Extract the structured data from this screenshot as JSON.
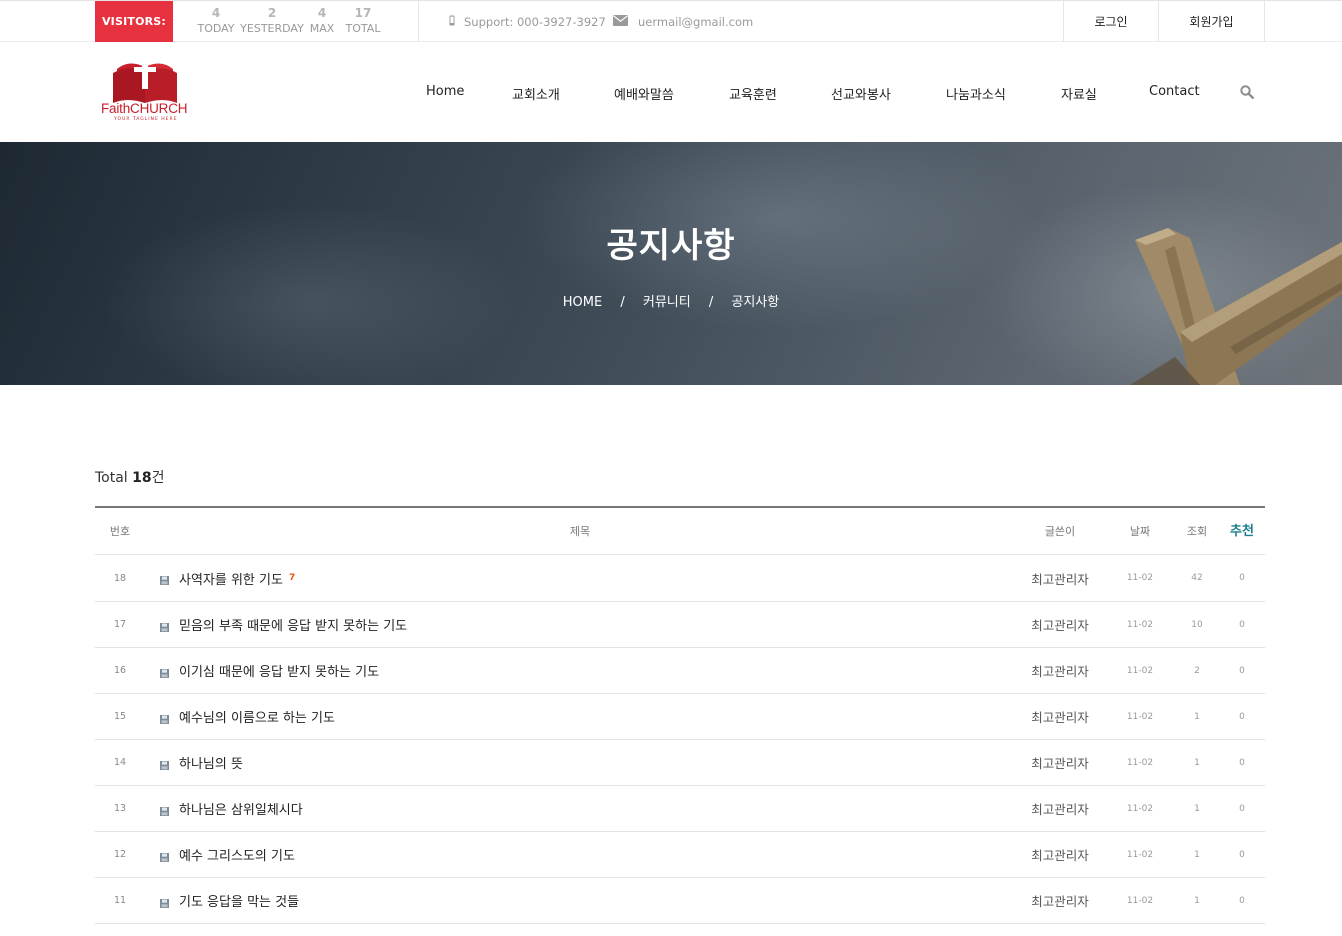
{
  "topbar": {
    "visitors_label": "VISITORS:",
    "stats": [
      {
        "value": "4",
        "label": "TODAY"
      },
      {
        "value": "2",
        "label": "YESTERDAY"
      },
      {
        "value": "4",
        "label": "MAX"
      },
      {
        "value": "17",
        "label": "TOTAL"
      }
    ],
    "support": "Support: 000-3927-3927",
    "email": "uermail@gmail.com",
    "login": "로그인",
    "signup": "회원가입"
  },
  "logo": {
    "name_light": "Faith",
    "name_bold": "CHURCH",
    "tagline": "YOUR TAGLINE HERE"
  },
  "nav": {
    "items": [
      "Home",
      "교회소개",
      "예배와말씀",
      "교육훈련",
      "선교와봉사",
      "나눔과소식",
      "자료실",
      "Contact"
    ]
  },
  "hero": {
    "title": "공지사항",
    "breadcrumb": [
      "HOME",
      "커뮤니티",
      "공지사항"
    ],
    "separator": "/"
  },
  "board": {
    "total_prefix": "Total",
    "total_count": "18",
    "total_suffix": "건",
    "headers": {
      "num": "번호",
      "subject": "제목",
      "writer": "글쓴이",
      "date": "날짜",
      "hits": "조회",
      "recommend": "추천"
    },
    "colors": {
      "accent": "#1d7f8e",
      "badge": "#e8313f",
      "comment": "#e8590c"
    },
    "rows": [
      {
        "num": "18",
        "subject": "사역자를 위한 기도",
        "comments": "7",
        "writer": "최고관리자",
        "date": "11-02",
        "hits": "42",
        "rec": "0"
      },
      {
        "num": "17",
        "subject": "믿음의 부족 때문에 응답 받지 못하는 기도",
        "comments": "",
        "writer": "최고관리자",
        "date": "11-02",
        "hits": "10",
        "rec": "0"
      },
      {
        "num": "16",
        "subject": "이기심 때문에 응답 받지 못하는 기도",
        "comments": "",
        "writer": "최고관리자",
        "date": "11-02",
        "hits": "2",
        "rec": "0"
      },
      {
        "num": "15",
        "subject": "예수님의 이름으로 하는 기도",
        "comments": "",
        "writer": "최고관리자",
        "date": "11-02",
        "hits": "1",
        "rec": "0"
      },
      {
        "num": "14",
        "subject": "하나님의 뜻",
        "comments": "",
        "writer": "최고관리자",
        "date": "11-02",
        "hits": "1",
        "rec": "0"
      },
      {
        "num": "13",
        "subject": "하나님은 삼위일체시다",
        "comments": "",
        "writer": "최고관리자",
        "date": "11-02",
        "hits": "1",
        "rec": "0"
      },
      {
        "num": "12",
        "subject": "예수 그리스도의 기도",
        "comments": "",
        "writer": "최고관리자",
        "date": "11-02",
        "hits": "1",
        "rec": "0"
      },
      {
        "num": "11",
        "subject": "기도 응답을 막는 것들",
        "comments": "",
        "writer": "최고관리자",
        "date": "11-02",
        "hits": "1",
        "rec": "0"
      }
    ]
  }
}
